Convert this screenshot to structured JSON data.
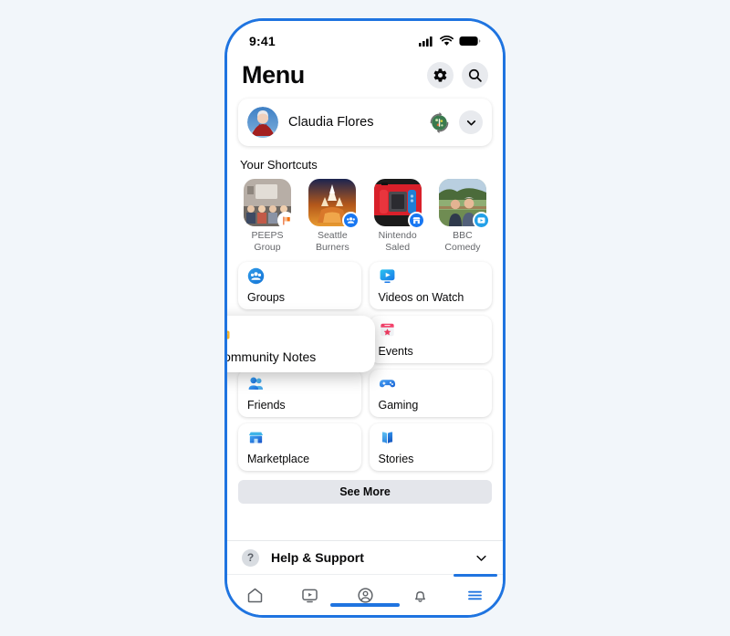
{
  "theme": {
    "frame_color": "#1f74e0",
    "page_background": "#f2f6fa",
    "accent_blue": "#1f74e0",
    "tile_background": "#ffffff",
    "see_more_background": "#e4e6eb",
    "muted_text": "#65676b"
  },
  "status_bar": {
    "time": "9:41",
    "signal_icon": "cellular-signal-icon",
    "wifi_icon": "wifi-icon",
    "battery_icon": "battery-icon"
  },
  "header": {
    "title": "Menu",
    "settings_icon": "gear-icon",
    "search_icon": "search-icon"
  },
  "profile": {
    "name": "Claudia Flores",
    "avatar_icon": "avatar",
    "switch_profile_icon": "switch-profile-icon",
    "expand_icon": "chevron-down-icon"
  },
  "shortcuts": {
    "title": "Your Shortcuts",
    "items": [
      {
        "label": "PEEPS\nGroup",
        "line1": "PEEPS",
        "line2": "Group",
        "badge_icon": "flag-badge-icon",
        "badge_color": "#f4700d"
      },
      {
        "label": "Seattle\nBurners",
        "line1": "Seattle",
        "line2": "Burners",
        "badge_icon": "group-badge-icon",
        "badge_color": "#1877f2"
      },
      {
        "label": "Nintendo\nSaled",
        "line1": "Nintendo",
        "line2": "Saled",
        "badge_icon": "marketplace-badge-icon",
        "badge_color": "#1877f2"
      },
      {
        "label": "BBC\nComedy",
        "line1": "BBC",
        "line2": "Comedy",
        "badge_icon": "video-badge-icon",
        "badge_color": "#22a0e8"
      }
    ]
  },
  "menu_grid": {
    "tiles": [
      {
        "label": "Groups",
        "icon": "groups-icon"
      },
      {
        "label": "Videos on Watch",
        "icon": "video-icon"
      },
      {
        "label": "Events",
        "icon": "events-calendar-icon"
      },
      {
        "label": "Friends",
        "icon": "friends-icon"
      },
      {
        "label": "Gaming",
        "icon": "gaming-controller-icon"
      },
      {
        "label": "Marketplace",
        "icon": "marketplace-storefront-icon"
      },
      {
        "label": "Stories",
        "icon": "stories-book-icon"
      }
    ],
    "highlighted_tile": {
      "label": "Community Notes",
      "icon": "community-notes-icon"
    },
    "see_more_label": "See More"
  },
  "help": {
    "label": "Help & Support",
    "icon": "question-mark-icon",
    "expand_icon": "chevron-down-icon"
  },
  "bottom_nav": {
    "items": [
      {
        "icon": "home-icon",
        "active": false
      },
      {
        "icon": "watch-video-icon",
        "active": false
      },
      {
        "icon": "friends-profile-icon",
        "active": false
      },
      {
        "icon": "notifications-bell-icon",
        "active": false
      },
      {
        "icon": "menu-hamburger-icon",
        "active": true
      }
    ]
  }
}
